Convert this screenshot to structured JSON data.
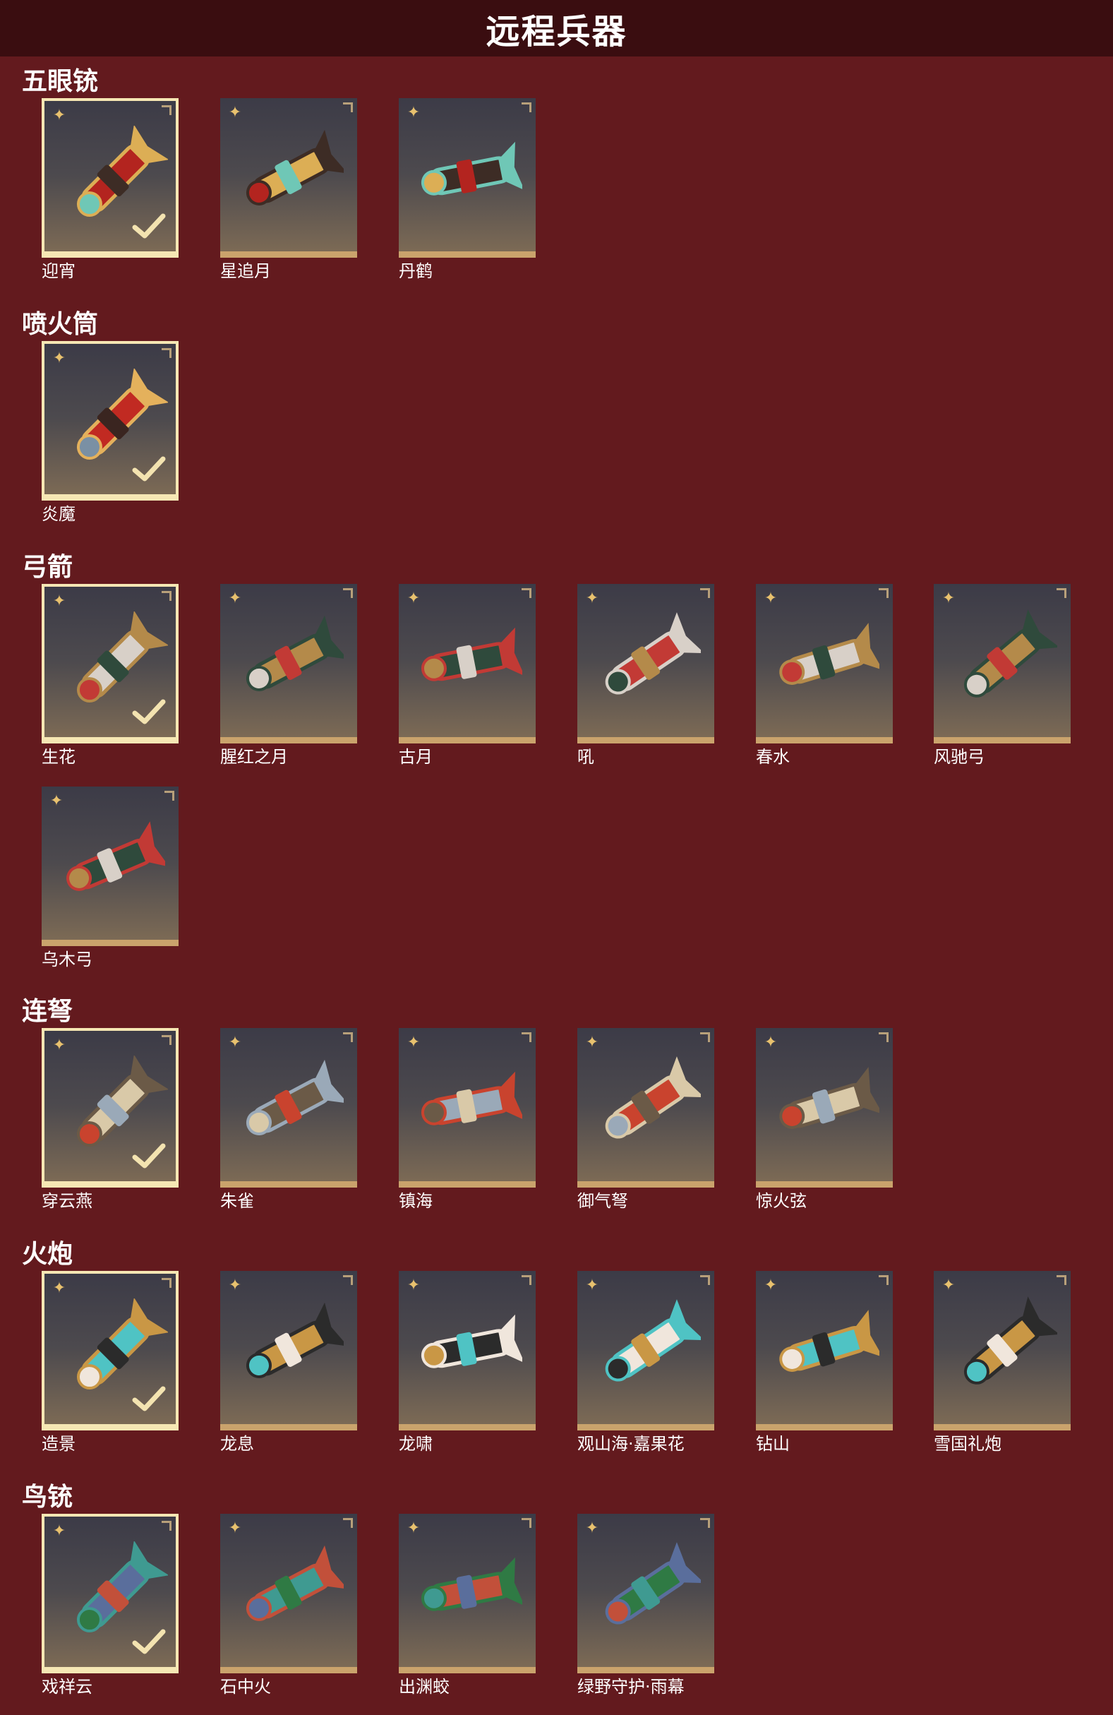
{
  "header": {
    "title": "远程兵器"
  },
  "sections": [
    {
      "title": "五眼铳",
      "items": [
        "迎宵",
        "星追月",
        "丹鹤"
      ]
    },
    {
      "title": "喷火筒",
      "items": [
        "炎魔"
      ]
    },
    {
      "title": "弓箭",
      "items": [
        "生花",
        "腥红之月",
        "古月",
        "吼",
        "春水",
        "风驰弓",
        "乌木弓"
      ]
    },
    {
      "title": "连弩",
      "items": [
        "穿云燕",
        "朱雀",
        "镇海",
        "御气弩",
        "惊火弦"
      ]
    },
    {
      "title": "火炮",
      "items": [
        "造景",
        "龙息",
        "龙啸",
        "观山海·嘉果花",
        "钻山",
        "雪国礼炮"
      ]
    },
    {
      "title": "鸟铳",
      "items": [
        "戏祥云",
        "石中火",
        "出渊蛟",
        "绿野守护·雨幕"
      ]
    }
  ],
  "colors": {
    "background": "#631a1e",
    "title_bar": "#3a0d10",
    "card_frame": "#caa36c",
    "selected_frame": "#f6e7b4",
    "star": "#e8c16e"
  },
  "icons": {
    "rarity": "star-icon",
    "owned": "check-icon"
  }
}
